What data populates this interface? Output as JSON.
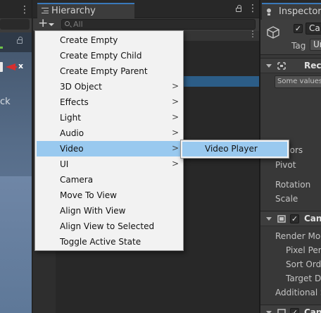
{
  "scene": {
    "gizmo_axis_label": "x",
    "edge_text": "ck"
  },
  "hierarchy": {
    "tab_label": "Hierarchy",
    "add_button_label": "+",
    "search_placeholder": "All"
  },
  "inspector": {
    "tab_label": "Inspector",
    "object_name": "Ca",
    "tag_label": "Tag",
    "tag_value": "Ur",
    "components": [
      {
        "title": "Rect"
      },
      {
        "title": "Canv"
      },
      {
        "title": "Canv"
      }
    ],
    "multi_value_text": "Some values",
    "props": {
      "anchors": "hors",
      "pivot": "Pivot",
      "rotation": "Rotation",
      "scale": "Scale",
      "render_mode": "Render Mod",
      "pixel_perfect": "Pixel Perf",
      "sort_order": "Sort Orde",
      "target_display": "Target Di",
      "additional": "Additional S"
    }
  },
  "context_menu": {
    "items": [
      {
        "label": "Create Empty",
        "submenu": false
      },
      {
        "label": "Create Empty Child",
        "submenu": false
      },
      {
        "label": "Create Empty Parent",
        "submenu": false
      },
      {
        "label": "3D Object",
        "submenu": true
      },
      {
        "label": "Effects",
        "submenu": true
      },
      {
        "label": "Light",
        "submenu": true
      },
      {
        "label": "Audio",
        "submenu": true
      },
      {
        "label": "Video",
        "submenu": true,
        "highlighted": true
      },
      {
        "label": "UI",
        "submenu": true
      },
      {
        "label": "Camera",
        "submenu": false
      },
      {
        "label": "Move To View",
        "submenu": false
      },
      {
        "label": "Align With View",
        "submenu": false
      },
      {
        "label": "Align View to Selected",
        "submenu": false
      },
      {
        "label": "Toggle Active State",
        "submenu": false
      }
    ],
    "submenu_arrow": ">",
    "video_submenu": {
      "items": [
        {
          "label": "Video Player",
          "highlighted": true
        }
      ]
    }
  },
  "colors": {
    "menu_highlight": "#99c9ef",
    "tab_accent": "#3a79bb",
    "selection_blue": "#2c5d87",
    "gizmo_red": "#d62f2f"
  }
}
